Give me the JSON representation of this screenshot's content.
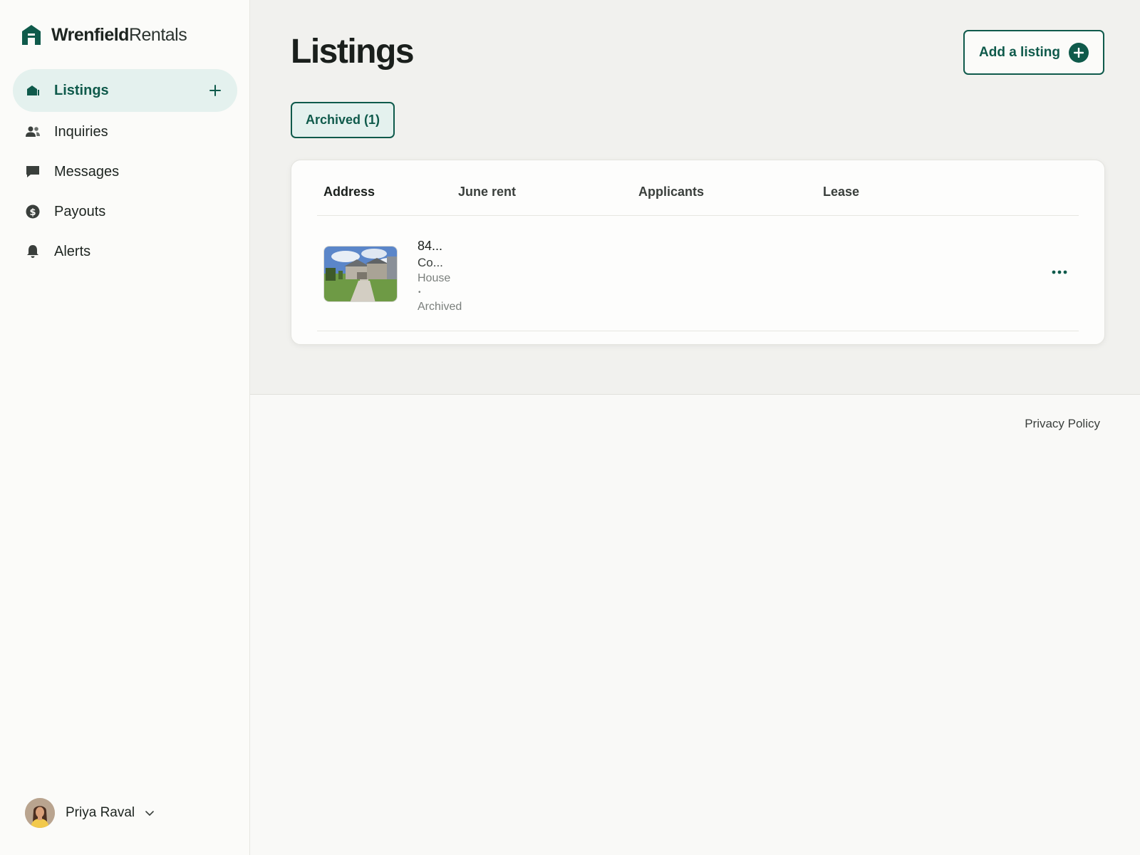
{
  "brand": {
    "name_bold": "Wrenfield",
    "name_light": "Rentals"
  },
  "nav": {
    "items": [
      {
        "label": "Listings",
        "icon": "house-icon",
        "active": true
      },
      {
        "label": "Inquiries",
        "icon": "people-icon",
        "active": false
      },
      {
        "label": "Messages",
        "icon": "chat-icon",
        "active": false
      },
      {
        "label": "Payouts",
        "icon": "dollar-icon",
        "active": false
      },
      {
        "label": "Alerts",
        "icon": "bell-icon",
        "active": false
      }
    ]
  },
  "user": {
    "name": "Priya Raval"
  },
  "page": {
    "title": "Listings",
    "add_button": "Add a listing",
    "filter": "Archived (1)"
  },
  "table": {
    "columns": [
      "Address",
      "June rent",
      "Applicants",
      "Lease"
    ],
    "rows": [
      {
        "address_line1": "84...",
        "address_line2": "Co...",
        "type": "House",
        "separator": "•",
        "status": "Archived"
      }
    ]
  },
  "footer": {
    "privacy": "Privacy Policy"
  },
  "colors": {
    "accent": "#0f5a4b",
    "accent_light": "#e4f1ee"
  }
}
